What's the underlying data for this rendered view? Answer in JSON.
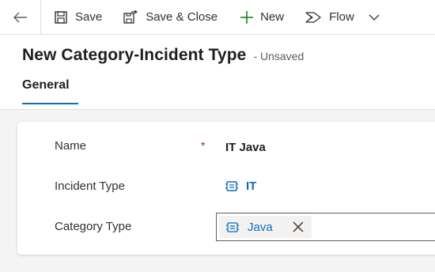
{
  "command_bar": {
    "save_label": "Save",
    "save_close_label": "Save & Close",
    "new_label": "New",
    "flow_label": "Flow"
  },
  "header": {
    "title": "New Category-Incident Type",
    "status": "- Unsaved"
  },
  "tabs": [
    {
      "label": "General",
      "selected": true
    }
  ],
  "form": {
    "name": {
      "label": "Name",
      "required_marker": "*",
      "value": "IT Java"
    },
    "incident_type": {
      "label": "Incident Type",
      "value": "IT"
    },
    "category_type": {
      "label": "Category Type",
      "value": "Java"
    }
  },
  "colors": {
    "accent": "#0f6cbd",
    "required": "#a4262c"
  },
  "icons": [
    "back-arrow-icon",
    "save-icon",
    "save-close-icon",
    "plus-icon",
    "flow-icon",
    "chevron-down-icon",
    "entity-icon",
    "remove-x-icon"
  ]
}
